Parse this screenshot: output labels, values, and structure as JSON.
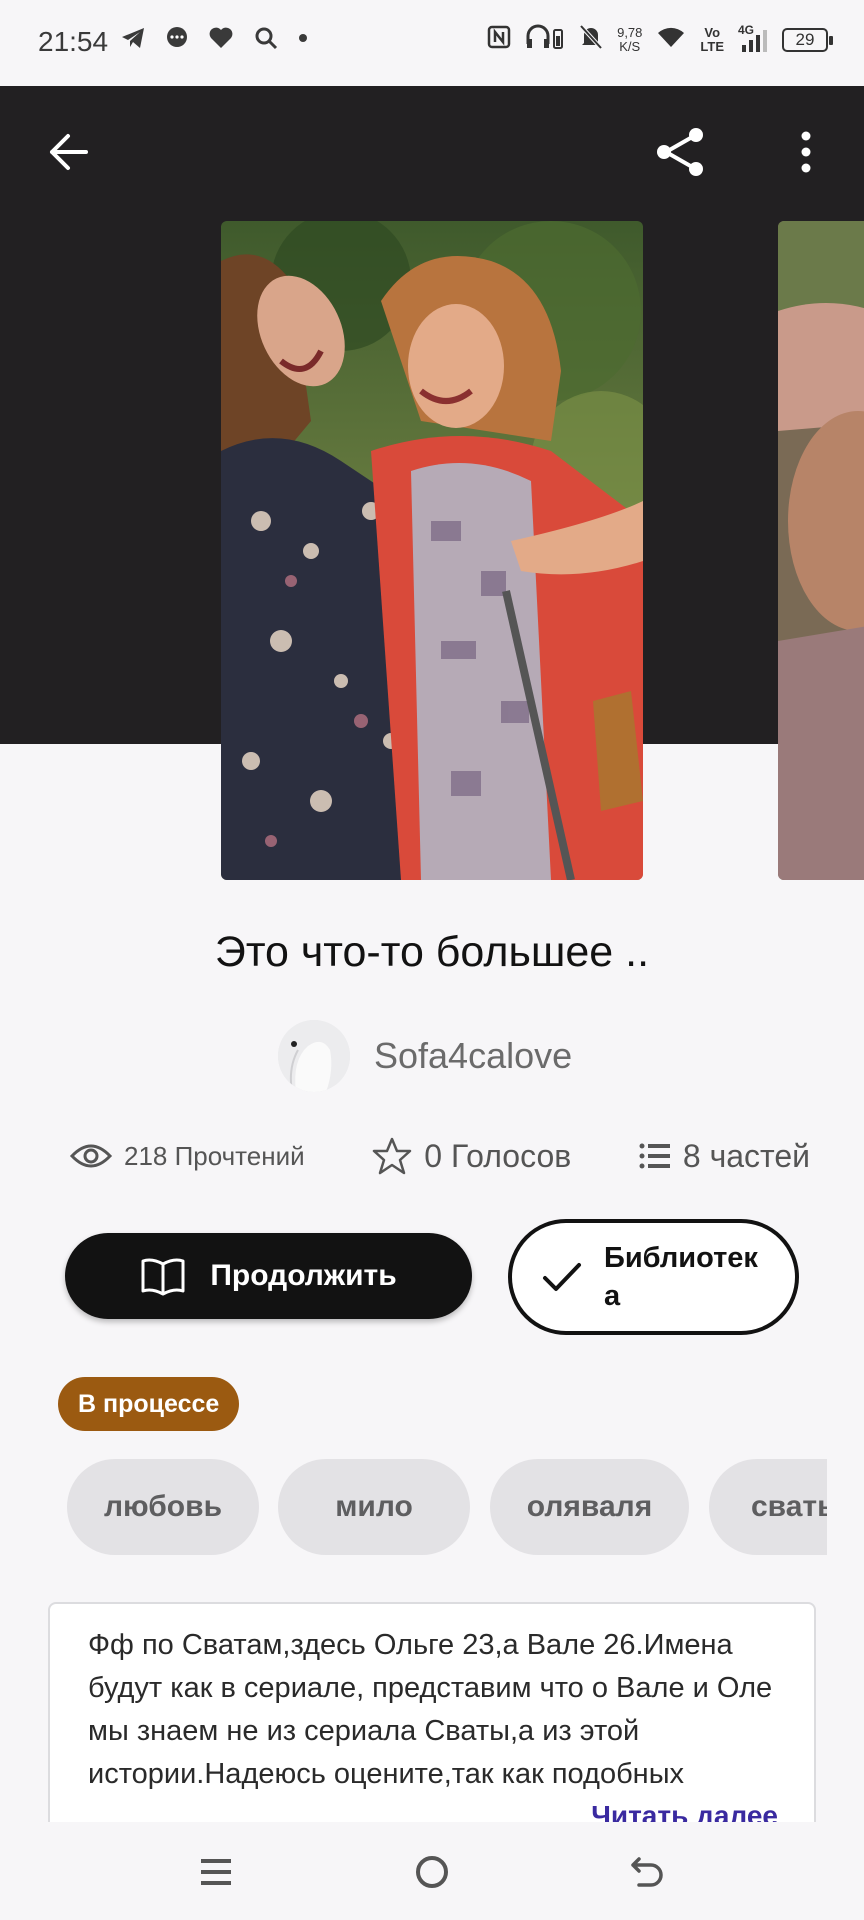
{
  "status_bar": {
    "time": "21:54",
    "left_icons": [
      "telegram-icon",
      "chat-icon",
      "heart-icon",
      "search-icon",
      "dot-icon"
    ],
    "net_speed_value": "9,78",
    "net_speed_unit": "K/S",
    "volte_top": "Vo",
    "volte_bottom": "LTE",
    "network": "4G",
    "battery": "29"
  },
  "topbar": {
    "back_icon": "arrow-left-icon",
    "share_icon": "share-icon",
    "more_icon": "more-vertical-icon"
  },
  "story": {
    "title": "Это что-то большее ..",
    "author": "Sofa4calove",
    "stats": {
      "reads": "218 Прочтений",
      "votes": "0 Голосов",
      "parts": "8 частей"
    },
    "continue_label": "Продолжить",
    "library_label": "Библиотека",
    "status_badge": "В процессе",
    "tags": [
      "любовь",
      "мило",
      "оляваля",
      "сваты"
    ],
    "description": "Фф по Сватам,здесь Ольге 23,а Вале 26.Имена будут как в сериале, представим что о Вале и Оле мы знаем не из сериала Сваты,а из этой истории.Надеюсь оцените,так как подобных",
    "read_more": "Читать далее"
  },
  "colors": {
    "hero_bg": "#222022",
    "button_dark": "#121212",
    "badge": "#9b5a11",
    "tag_bg": "#e3e2e5",
    "link": "#3a2aa0"
  }
}
